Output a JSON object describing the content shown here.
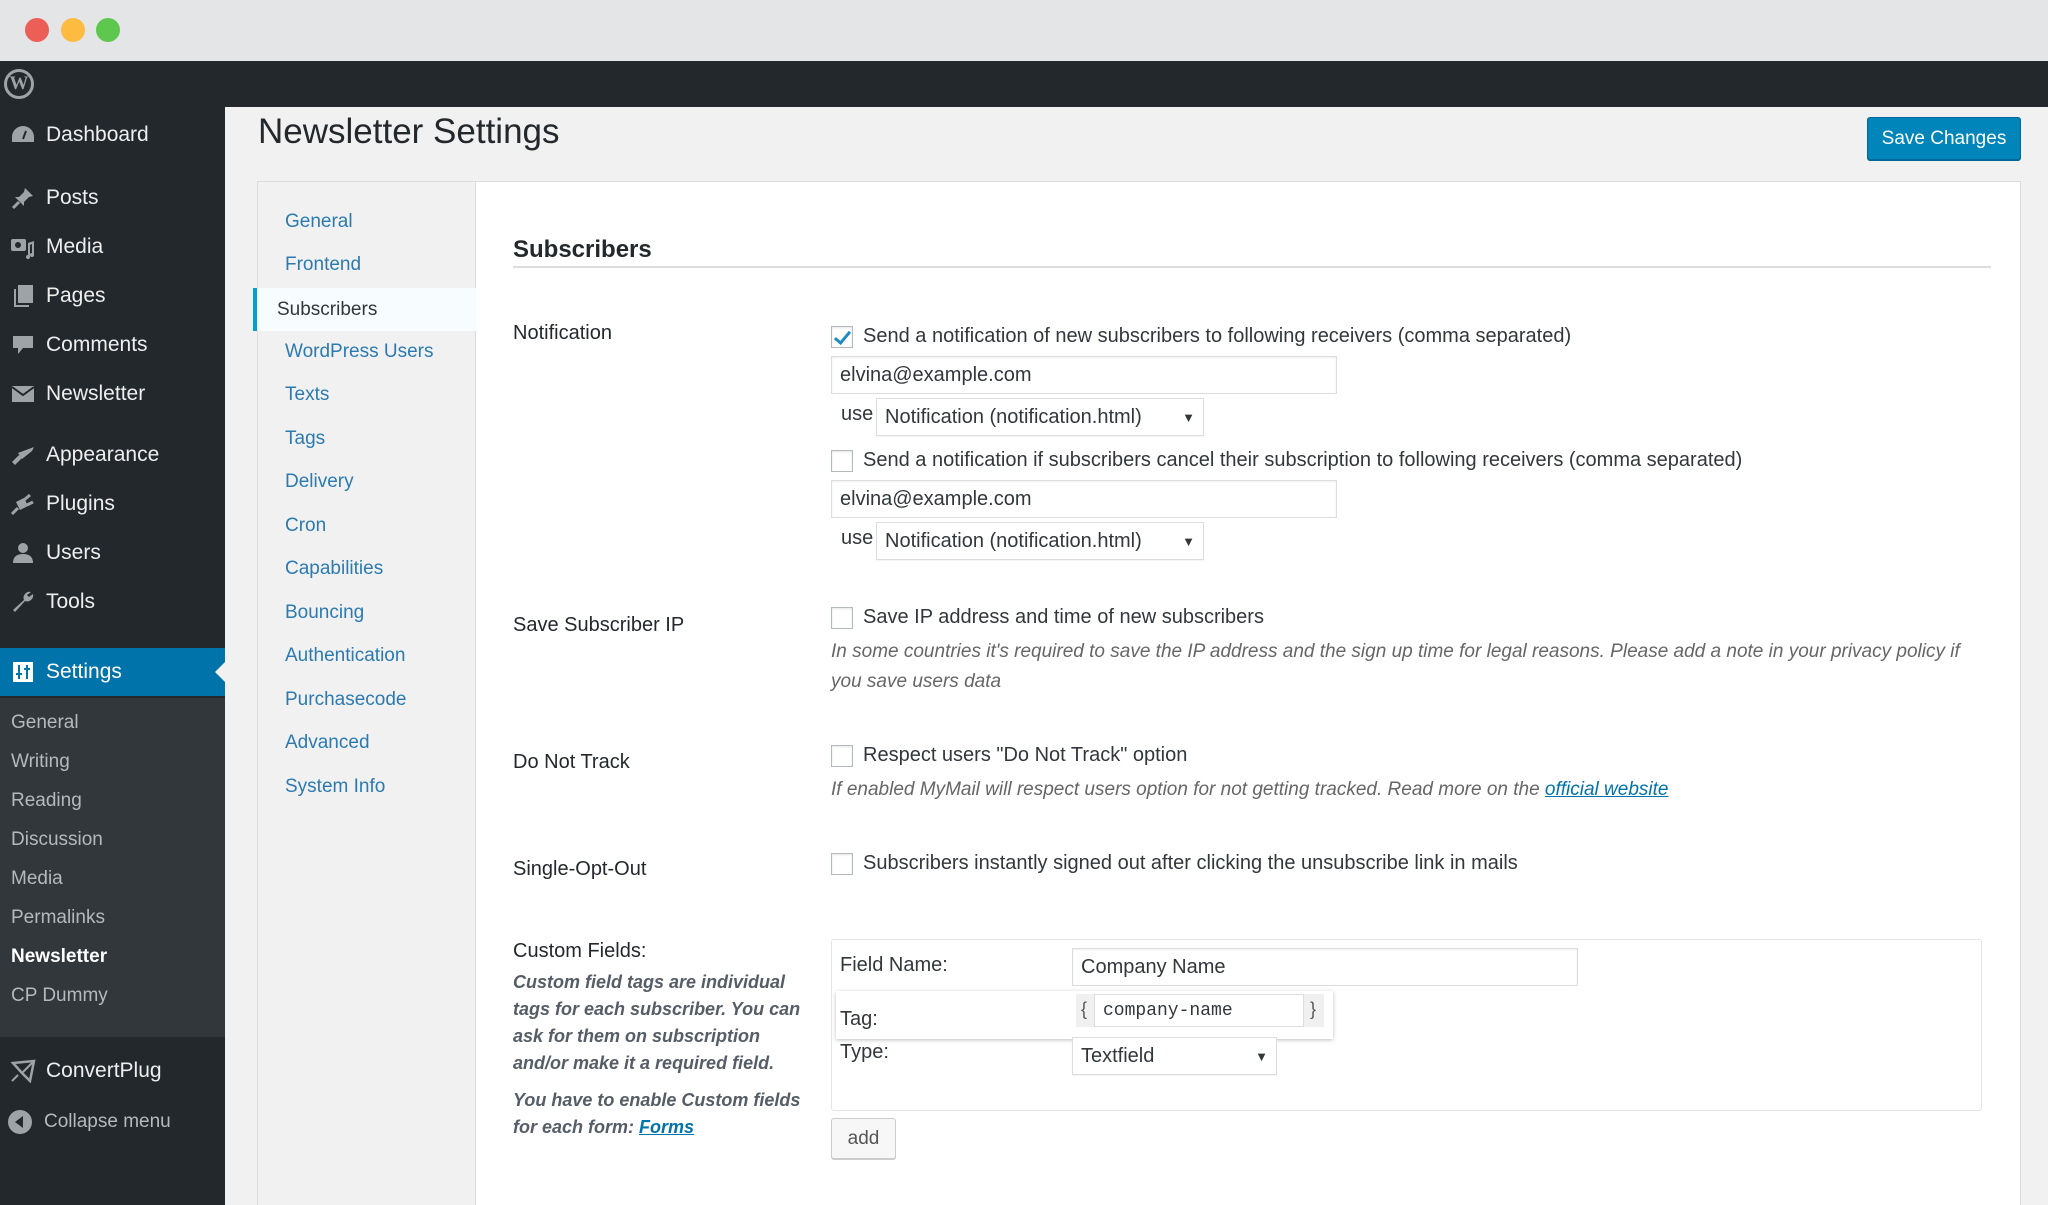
{
  "window": {
    "traffic_lights": [
      "close",
      "minimize",
      "maximize"
    ]
  },
  "adminbar": {
    "logo_icon": "wordpress-logo-icon",
    "logo_glyph": "W"
  },
  "sidebar": {
    "items": [
      {
        "label": "Dashboard",
        "icon": "dashboard-icon",
        "glyph": "◔"
      },
      {
        "label": "Posts",
        "icon": "pushpin-icon",
        "glyph": "📌"
      },
      {
        "label": "Media",
        "icon": "media-icon",
        "glyph": "▣"
      },
      {
        "label": "Pages",
        "icon": "pages-icon",
        "glyph": "❐"
      },
      {
        "label": "Comments",
        "icon": "comment-icon",
        "glyph": "▰"
      },
      {
        "label": "Newsletter",
        "icon": "envelope-icon",
        "glyph": "✉"
      },
      {
        "label": "Appearance",
        "icon": "paintbrush-icon",
        "glyph": "✎"
      },
      {
        "label": "Plugins",
        "icon": "plug-icon",
        "glyph": "⚡"
      },
      {
        "label": "Users",
        "icon": "user-icon",
        "glyph": "👤"
      },
      {
        "label": "Tools",
        "icon": "wrench-icon",
        "glyph": "🔧"
      },
      {
        "label": "Settings",
        "icon": "settings-sliders-icon",
        "glyph": "⇅",
        "active": true
      }
    ],
    "submenu": [
      "General",
      "Writing",
      "Reading",
      "Discussion",
      "Media",
      "Permalinks",
      "Newsletter",
      "CP Dummy"
    ],
    "submenu_current": "Newsletter",
    "extra_items": [
      {
        "label": "ConvertPlug",
        "icon": "paper-plane-icon",
        "glyph": "✈"
      }
    ],
    "collapse_label": "Collapse menu"
  },
  "header": {
    "title": "Newsletter Settings",
    "save_label": "Save Changes"
  },
  "settings_nav": {
    "items": [
      "General",
      "Frontend",
      "Subscribers",
      "WordPress Users",
      "Texts",
      "Tags",
      "Delivery",
      "Cron",
      "Capabilities",
      "Bouncing",
      "Authentication",
      "Purchasecode",
      "Advanced",
      "System Info"
    ],
    "current": "Subscribers"
  },
  "section": {
    "title": "Subscribers",
    "notification": {
      "label": "Notification",
      "new_subscriber": {
        "checked": true,
        "label": "Send a notification of new subscribers to following receivers (comma separated)",
        "email": "elvina@example.com",
        "use_label": "use",
        "template": "Notification (notification.html)"
      },
      "cancel_subscription": {
        "checked": false,
        "label": "Send a notification if subscribers cancel their subscription to following receivers (comma separated)",
        "email": "elvina@example.com",
        "use_label": "use",
        "template": "Notification (notification.html)"
      }
    },
    "save_ip": {
      "label": "Save Subscriber IP",
      "checked": false,
      "checkbox_label": "Save IP address and time of new subscribers",
      "description": "In some countries it's required to save the IP address and the sign up time for legal reasons. Please add a note in your privacy policy if you save users data"
    },
    "do_not_track": {
      "label": "Do Not Track",
      "checked": false,
      "checkbox_label": "Respect users \"Do Not Track\" option",
      "description": "If enabled MyMail will respect users option for not getting tracked. Read more on the ",
      "link": "official website"
    },
    "single_opt_out": {
      "label": "Single-Opt-Out",
      "checked": false,
      "checkbox_label": "Subscribers instantly signed out after clicking the unsubscribe link in mails"
    },
    "custom_fields": {
      "label": "Custom Fields:",
      "description": "Custom field tags are individual tags for each subscriber. You can ask for them on subscription and/or make it a required field.",
      "note": "You have to enable Custom fields for each form: ",
      "note_link": "Forms",
      "field_name_label": "Field Name:",
      "field_name_value": "Company Name",
      "tag_label": "Tag:",
      "tag_open": "{",
      "tag_value": "company-name",
      "tag_close": "}",
      "type_label": "Type:",
      "type_value": "Textfield",
      "add_label": "add"
    }
  },
  "colors": {
    "accent": "#0073aa",
    "button": "#0085ba",
    "sidebar_bg": "#23282d",
    "submenu_bg": "#32373c",
    "link": "#2c7ab0"
  }
}
